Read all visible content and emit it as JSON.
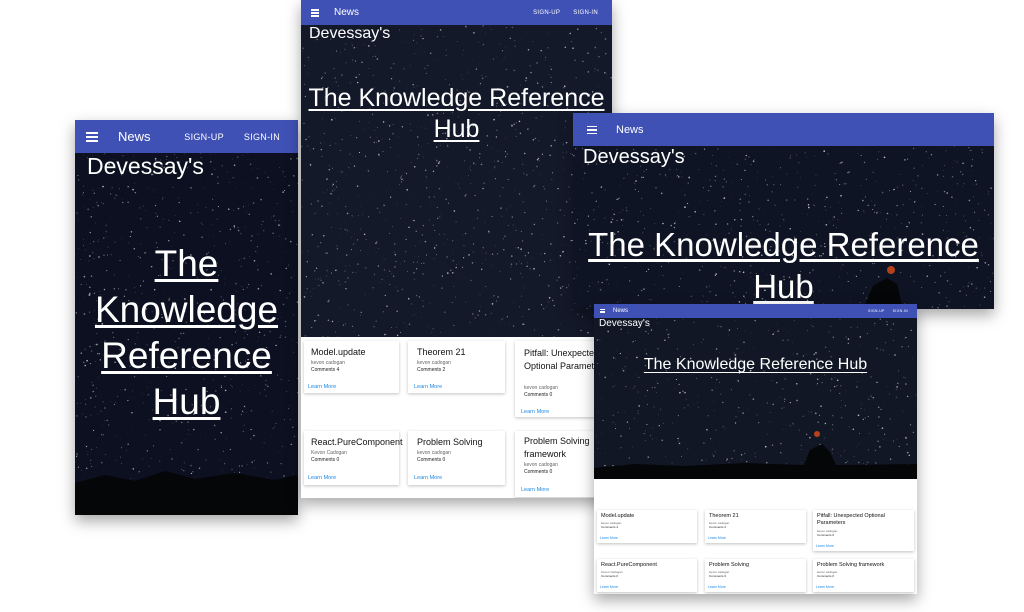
{
  "appbar": {
    "title": "News",
    "signup": "SIGN-UP",
    "signin": "SIGN-IN"
  },
  "hero": {
    "brand": "Devessay's",
    "title": "The Knowledge Reference Hub"
  },
  "cards": [
    {
      "title": "Model.update",
      "author": "kevon cadogan",
      "comments": "Comments 4",
      "link": "Learn More"
    },
    {
      "title": "Theorem 21",
      "author": "kevon cadogan",
      "comments": "Comments 2",
      "link": "Learn More"
    },
    {
      "title": "Pitfall: Unexpected Optional Parameters",
      "author": "kevon cadogan",
      "comments": "Comments 0",
      "link": "Learn More"
    },
    {
      "title": "React.PureComponent",
      "author": "Kevon Cadogan",
      "comments": "Comments 0",
      "link": "Learn More"
    },
    {
      "title": "Problem Solving",
      "author": "kevon cadogan",
      "comments": "Comments 0",
      "link": "Learn More"
    },
    {
      "title": "Problem Solving framework",
      "author": "kevon cadogan",
      "comments": "Comments 0",
      "link": "Learn More"
    }
  ],
  "colors": {
    "appbar": "#3f51b5",
    "link": "#1e88e5",
    "hero_bg": "#0b0e18"
  },
  "icons": {
    "menu": "hamburger-menu-icon"
  }
}
